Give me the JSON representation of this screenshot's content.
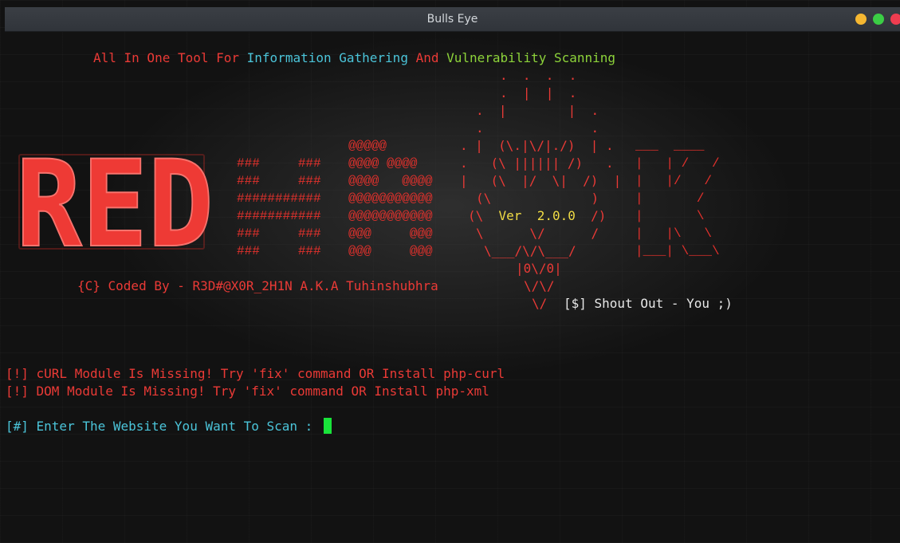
{
  "window": {
    "title": "Bulls Eye"
  },
  "banner": {
    "part1": "All In One Tool For ",
    "part2": "Information Gathering ",
    "part3": "And ",
    "part4": "Vulnerability Scanning"
  },
  "logo_text": "RED",
  "ascii": {
    "eye": ".  .  .  .\n.  |  |  .\n.  |        |  .\n.              .\n.  |  (\\.|\\/|./)  | .\n.   (\\ |||||| /)   .\n|   (\\  |/  \\|  /)  |\n(\\             )\n(\\  Ver  2.0.0  /)\n\\      \\/      /\n \\___/\\/\\___/\n      |0\\/0|\n       \\/\\/\n        \\/",
    "hawk": "@@@@@\n@@@@ @@@@\n@@@@   @@@@\n@@@@@@@@@@@\n@@@@@@@@@@@\n@@@     @@@\n@@@     @@@",
    "hash": "###     ###\n###     ###\n###########\n###########\n###     ###\n###     ###",
    "right": "___  ____\n|   | /   /\n|   |/   /\n|       /\n|       \\\n|   |\\   \\\n|___| \\___\\"
  },
  "credit": "{C} Coded By - R3D#@X0R_2H1N A.K.A Tuhinshubhra",
  "version": "Ver  2.0.0",
  "shoutout": "[$] Shout Out - You ;)",
  "messages": [
    "[!] cURL Module Is Missing! Try 'fix' command OR Install php-curl",
    "[!] DOM Module Is Missing! Try 'fix' command OR Install php-xml"
  ],
  "prompt": "[#] Enter The Website You Want To Scan : ",
  "colors": {
    "red": "#ea3a36",
    "cyan": "#4bc4d9",
    "green": "#8dd33a",
    "yellow": "#f1dc45",
    "cursor": "#19e33a"
  }
}
